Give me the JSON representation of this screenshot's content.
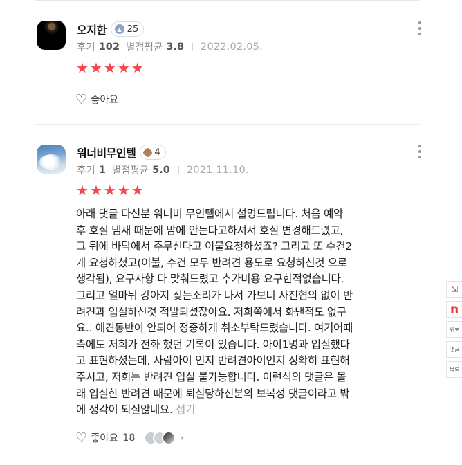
{
  "reviews": [
    {
      "name": "오지한",
      "badge_count": "25",
      "reviews_label": "후기",
      "reviews_count": "102",
      "avg_label": "별점평균",
      "avg_value": "3.8",
      "date": "2022.02.05.",
      "rating": 5,
      "star_glyph": "★",
      "like_label": "좋아요",
      "like_count": ""
    },
    {
      "name": "워너비무인텔",
      "badge_count": "4",
      "reviews_label": "후기",
      "reviews_count": "1",
      "avg_label": "별점평균",
      "avg_value": "5.0",
      "date": "2021.11.10.",
      "rating": 5,
      "star_glyph": "★",
      "body": "아래 댓글 다신분 워너비 무인텔에서 설명드립니다.  처음 예약\n후 호실 냄새 때문에 맘에 안든다고하셔서  호실 변경해드렸고,\n그 뒤에 바닥에서 주무신다고 이불요청하셨죠? 그리고 또  수건2\n개 요청하셨고(이불, 수건 모두 반려견 용도로 요청하신것 으로\n생각됨), 요구사항 다 맞춰드렸고 추가비용 요구한적없습니다.\n그리고 얼마뒤 강아지 짖는소리가 나서 가보니 사전협의 없이 반\n려견과 입실하신것 적발되셨잖아요. 저희쪽에서 화낸적도 없구\n요.. 애견동반이 안되어 정중하게 취소부탁드렸습니다. 여기어때\n측에도 저희가 전화 했던 기록이 있습니다.   아이1명과 입실했다\n고 표현하셨는데, 사람아이 인지 반려견아이인지 정확히 표현해\n주시고, 저희는 반려견 입실 불가능합니다.  이런식의 댓글은 몰\n래 입실한 반려견 때문에 퇴실당하신분의 보복성 댓글이라고 밖\n에 생각이 되질않네요.",
      "collapse_label": "접기",
      "like_label": "좋아요",
      "like_count": "18"
    }
  ],
  "side_buttons": {
    "first": "⇲",
    "naver": "n",
    "top": "위로",
    "comments": "댓글",
    "list": "목록"
  },
  "colors": {
    "star": "#f2484f",
    "naver": "#e53b2c"
  }
}
